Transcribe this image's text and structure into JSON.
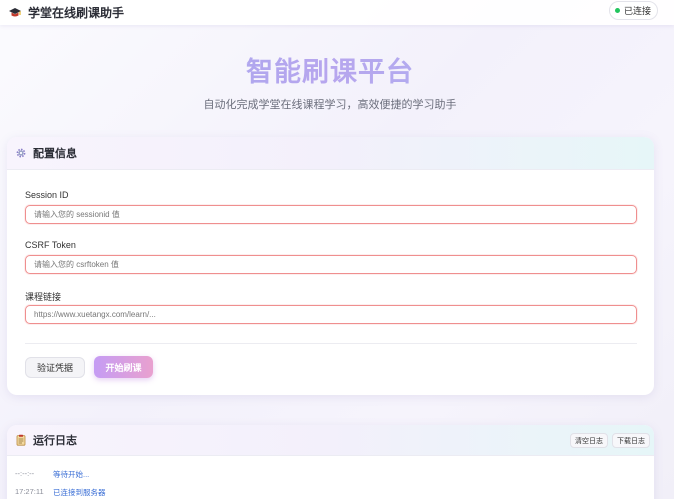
{
  "app": {
    "title": "学堂在线刷课助手",
    "logo_icon": "graduation-cap-icon",
    "status": "已连接",
    "status_color": "#22c55e"
  },
  "hero": {
    "title": "智能刷课平台",
    "subtitle": "自动化完成学堂在线课程学习，高效便捷的学习助手"
  },
  "config": {
    "title": "配置信息",
    "icon": "gear-icon",
    "fields": [
      {
        "label": "Session ID",
        "value": "",
        "placeholder": "请输入您的 sessionid 值"
      },
      {
        "label": "CSRF Token",
        "value": "",
        "placeholder": "请输入您的 csrftoken 值"
      },
      {
        "label": "课程链接",
        "value": "",
        "placeholder": "https://www.xuetangx.com/learn/..."
      }
    ],
    "verify_button": "验证凭据",
    "start_button": "开始刷课",
    "accent_color": "#ef8f8f"
  },
  "log": {
    "title": "运行日志",
    "icon": "clipboard-icon",
    "clear_button": "清空日志",
    "download_button": "下载日志",
    "entries": [
      {
        "time": "--:--:--",
        "message": "等待开始..."
      },
      {
        "time": "17:27:11",
        "message": "已连接到服务器"
      }
    ]
  }
}
